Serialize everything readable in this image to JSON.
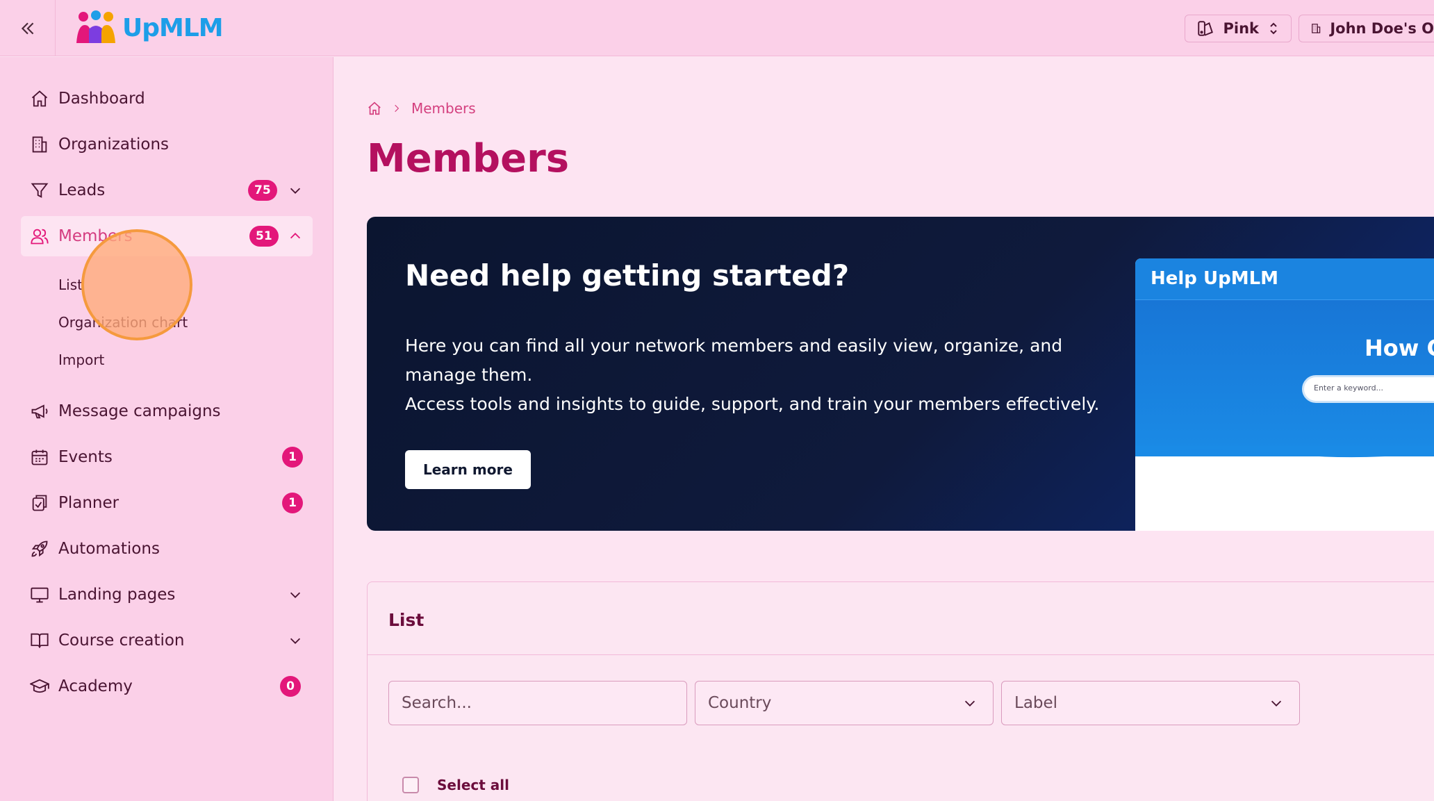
{
  "app": {
    "name": "UpMLM"
  },
  "header": {
    "collapse_icon": "double-chevron-left-icon",
    "theme_select": {
      "value": "Pink",
      "icon": "palette-icon"
    },
    "org_select": {
      "value": "John Doe's O",
      "icon": "building-icon"
    }
  },
  "sidebar": {
    "items": [
      {
        "label": "Dashboard",
        "icon": "home-icon"
      },
      {
        "label": "Organizations",
        "icon": "building-icon"
      },
      {
        "label": "Leads",
        "icon": "funnel-icon",
        "badge": "75"
      },
      {
        "label": "Members",
        "icon": "users-icon",
        "badge": "51"
      },
      {
        "label": "Message campaigns",
        "icon": "megaphone-icon"
      },
      {
        "label": "Events",
        "icon": "calendar-icon",
        "badge": "1"
      },
      {
        "label": "Planner",
        "icon": "clipboard-icon",
        "badge": "1"
      },
      {
        "label": "Automations",
        "icon": "rocket-icon"
      },
      {
        "label": "Landing pages",
        "icon": "monitor-icon"
      },
      {
        "label": "Course creation",
        "icon": "book-icon"
      },
      {
        "label": "Academy",
        "icon": "graduation-cap-icon",
        "badge": "0"
      }
    ],
    "members_sub": [
      "List",
      "Organization chart",
      "Import"
    ]
  },
  "breadcrumb": {
    "current": "Members"
  },
  "page_title": "Members",
  "hero": {
    "title": "Need help getting started?",
    "line1": "Here you can find all your network members and easily view, organize, and manage them.",
    "line2": "Access tools and insights to guide, support, and train your members effectively.",
    "button": "Learn more",
    "preview_title": "Help UpMLM",
    "preview_heading": "How C",
    "preview_search_placeholder": "Enter a keyword..."
  },
  "list": {
    "title": "List",
    "search_placeholder": "Search...",
    "country_label": "Country",
    "label_label": "Label",
    "select_all": "Select all"
  },
  "colors": {
    "accent": "#e3177a",
    "title": "#b4105f",
    "sidebar_bg": "#fbd0e8",
    "page_bg": "#fde4f2"
  }
}
